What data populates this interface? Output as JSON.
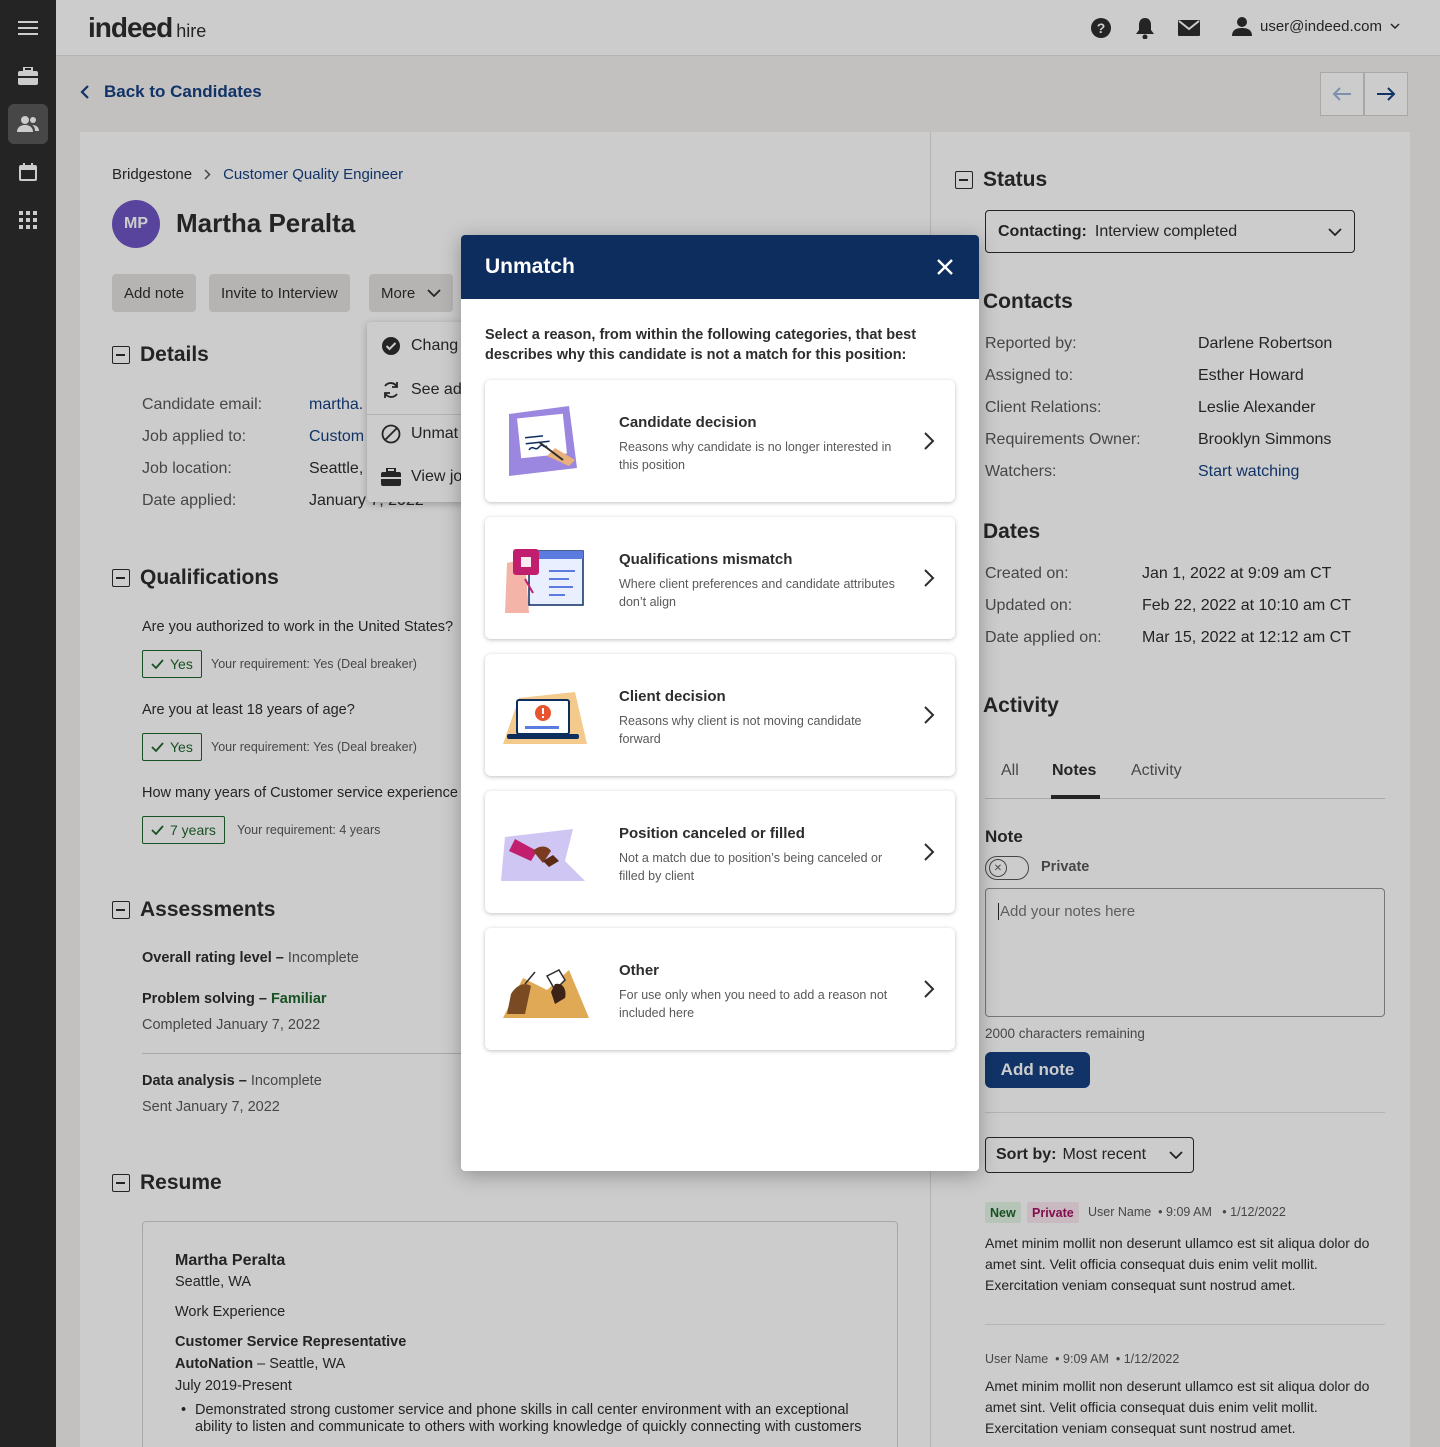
{
  "header": {
    "logo_main": "indeed",
    "logo_sub": "hire",
    "user_email": "user@indeed.com"
  },
  "nav": {
    "back_label": "Back to Candidates"
  },
  "candidate": {
    "company": "Bridgestone",
    "job_title": "Customer Quality Engineer",
    "initials": "MP",
    "name": "Martha Peralta"
  },
  "actions": {
    "add_note": "Add note",
    "invite": "Invite to Interview",
    "more": "More"
  },
  "more_menu": {
    "items": [
      "Chang",
      "See ad",
      "Unmat",
      "View jo"
    ]
  },
  "details": {
    "title": "Details",
    "rows": [
      {
        "label": "Candidate email:",
        "value": "martha."
      },
      {
        "label": "Job applied to:",
        "value": "Custom"
      },
      {
        "label": "Job location:",
        "value": "Seattle,"
      },
      {
        "label": "Date applied:",
        "value": "January 7, 2022"
      }
    ]
  },
  "qualifications": {
    "title": "Qualifications",
    "items": [
      {
        "question": "Are you authorized to work in the United States?",
        "answer": "Yes",
        "requirement": "Your requirement: Yes (Deal breaker)"
      },
      {
        "question": "Are you at least 18 years of age?",
        "answer": "Yes",
        "requirement": "Your requirement: Yes (Deal breaker)"
      },
      {
        "question": "How many years of Customer service experience",
        "answer": "7 years",
        "requirement": "Your requirement: 4 years"
      }
    ]
  },
  "assessments": {
    "title": "Assessments",
    "overall_label": "Overall rating level –",
    "overall_value": "Incomplete",
    "problem_label": "Problem solving –",
    "problem_value": "Familiar",
    "problem_date": "Completed January 7, 2022",
    "data_label": "Data analysis –",
    "data_value": "Incomplete",
    "data_date": "Sent January 7, 2022"
  },
  "resume": {
    "title": "Resume",
    "name": "Martha Peralta",
    "location": "Seattle, WA",
    "section": "Work Experience",
    "role": "Customer Service Representative",
    "company": "AutoNation",
    "company_loc": "– Seattle, WA",
    "period": "July 2019-Present",
    "bullet": "Demonstrated strong customer service and phone skills in call center environment with an exceptional ability to listen and communicate to others with working knowledge of quickly connecting with customers"
  },
  "status": {
    "title": "Status",
    "select_label": "Contacting:",
    "select_value": "Interview completed"
  },
  "contacts": {
    "title": "Contacts",
    "rows": [
      {
        "label": "Reported by:",
        "value": "Darlene Robertson"
      },
      {
        "label": "Assigned to:",
        "value": "Esther Howard"
      },
      {
        "label": "Client Relations:",
        "value": "Leslie Alexander"
      },
      {
        "label": "Requirements Owner:",
        "value": "Brooklyn Simmons"
      },
      {
        "label": "Watchers:",
        "value": "Start watching"
      }
    ]
  },
  "dates": {
    "title": "Dates",
    "rows": [
      {
        "label": "Created on:",
        "value": "Jan 1, 2022 at 9:09 am CT"
      },
      {
        "label": "Updated on:",
        "value": "Feb 22, 2022 at 10:10 am CT"
      },
      {
        "label": "Date applied on:",
        "value": "Mar 15, 2022 at 12:12 am CT"
      }
    ]
  },
  "activity": {
    "title": "Activity",
    "tabs": [
      "All",
      "Notes",
      "Activity"
    ],
    "note_title": "Note",
    "private_label": "Private",
    "placeholder": "Add your notes here",
    "chars_remaining": "2000 characters remaining",
    "add_note": "Add note",
    "sort_label": "Sort by:",
    "sort_value": "Most recent",
    "notes": [
      {
        "badge_new": "New",
        "badge_private": "Private",
        "user": "User Name",
        "time": "9:09 AM",
        "date": "1/12/2022",
        "body": "Amet minim mollit non deserunt ullamco est sit aliqua dolor do amet sint. Velit officia consequat duis enim velit mollit. Exercitation veniam consequat sunt nostrud amet."
      },
      {
        "user": "User Name",
        "time": "9:09 AM",
        "date": "1/12/2022",
        "body": "Amet minim mollit non deserunt ullamco est sit aliqua dolor do amet sint. Velit officia consequat duis enim velit mollit. Exercitation veniam consequat sunt nostrud amet."
      }
    ]
  },
  "modal": {
    "title": "Unmatch",
    "intro": "Select a reason, from within the following categories, that best describes why this candidate is not a match for this position:",
    "reasons": [
      {
        "title": "Candidate decision",
        "desc": "Reasons why candidate is no longer interested in this position",
        "icon": "signing-contract-icon"
      },
      {
        "title": "Qualifications mismatch",
        "desc": "Where client preferences and candidate attributes don’t align",
        "icon": "puzzle-mismatch-icon"
      },
      {
        "title": "Client decision",
        "desc": "Reasons why client is not moving candidate forward",
        "icon": "laptop-alert-icon"
      },
      {
        "title": "Position canceled or filled",
        "desc": "Not a match due to position’s being canceled or filled by client",
        "icon": "handshake-icon"
      },
      {
        "title": "Other",
        "desc": "For use only when you need to add a reason not included here",
        "icon": "hands-icon"
      }
    ]
  },
  "colors": {
    "brand_blue": "#164081",
    "modal_header": "#0d2d5e",
    "avatar": "#6f56c5",
    "success": "#1f662c",
    "rail": "#2d2d2d"
  }
}
